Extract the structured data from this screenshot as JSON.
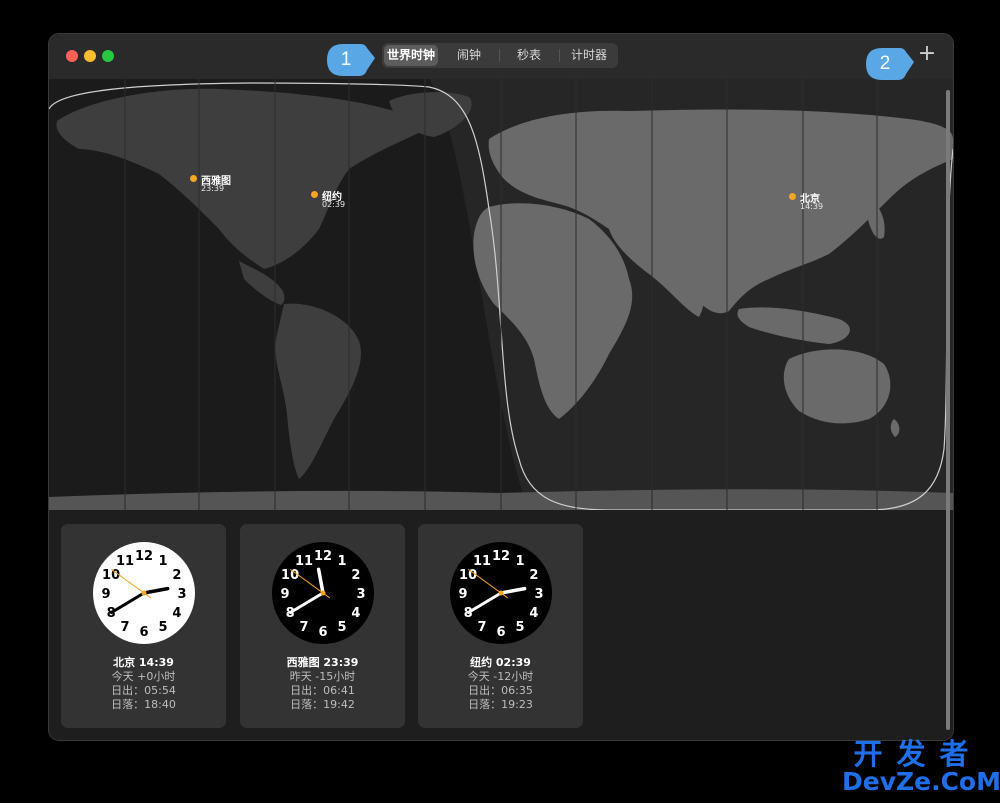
{
  "titlebar": {
    "tabs": [
      {
        "label": "世界时钟",
        "active": true
      },
      {
        "label": "闹钟"
      },
      {
        "label": "秒表"
      },
      {
        "label": "计时器"
      }
    ],
    "add_label": "+"
  },
  "callouts": {
    "one": "1",
    "two": "2"
  },
  "map": {
    "pins": [
      {
        "city": "西雅图",
        "time": "23:39"
      },
      {
        "city": "纽约",
        "time": "02:39"
      },
      {
        "city": "北京",
        "time": "14:39"
      }
    ]
  },
  "clocks": [
    {
      "city_time": "北京 14:39",
      "day_offset": "今天 +0小时",
      "sunrise": "日出：05:54",
      "sunset": "日落：18:40",
      "theme": "light",
      "time": {
        "hour": 14,
        "minute": 39,
        "second": 51
      }
    },
    {
      "city_time": "西雅图 23:39",
      "day_offset": "昨天 -15小时",
      "sunrise": "日出：06:41",
      "sunset": "日落：19:42",
      "theme": "dark",
      "time": {
        "hour": 23,
        "minute": 39,
        "second": 51
      }
    },
    {
      "city_time": "纽约 02:39",
      "day_offset": "今天 -12小时",
      "sunrise": "日出：06:35",
      "sunset": "日落：19:23",
      "theme": "dark",
      "time": {
        "hour": 2,
        "minute": 39,
        "second": 51
      }
    }
  ],
  "clock_numbers": [
    "12",
    "1",
    "2",
    "3",
    "4",
    "5",
    "6",
    "7",
    "8",
    "9",
    "10",
    "11"
  ],
  "watermark": {
    "line1": "开发者",
    "line2": "DevZe.CoM"
  },
  "colors": {
    "accent": "#f5a623",
    "callout": "#5aa7e6",
    "watermark": "#1e6fe8"
  }
}
